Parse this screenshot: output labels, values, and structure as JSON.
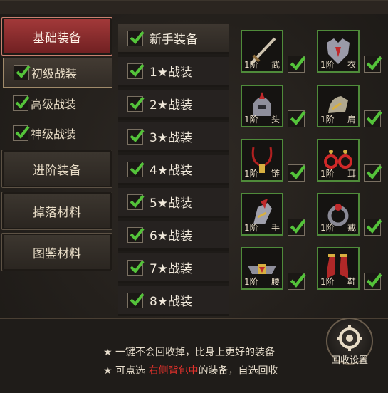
{
  "categories": [
    {
      "label": "基础装备"
    },
    {
      "label": "进阶装备"
    },
    {
      "label": "掉落材料"
    },
    {
      "label": "图鉴材料"
    }
  ],
  "sub_items": [
    {
      "label": "初级战装"
    },
    {
      "label": "高级战装"
    },
    {
      "label": "神级战装"
    }
  ],
  "mid_list": {
    "header": "新手装备",
    "items": [
      "1★战装",
      "2★战装",
      "3★战装",
      "4★战装",
      "5★战装",
      "6★战装",
      "7★战装",
      "8★战装"
    ]
  },
  "slots": [
    {
      "level": "1阶",
      "part": "武",
      "icon": "sword-icon"
    },
    {
      "level": "1阶",
      "part": "衣",
      "icon": "armor-icon"
    },
    {
      "level": "1阶",
      "part": "头",
      "icon": "helmet-icon"
    },
    {
      "level": "1阶",
      "part": "肩",
      "icon": "shoulder-icon"
    },
    {
      "level": "1阶",
      "part": "链",
      "icon": "necklace-icon"
    },
    {
      "level": "1阶",
      "part": "耳",
      "icon": "earring-icon"
    },
    {
      "level": "1阶",
      "part": "手",
      "icon": "glove-icon"
    },
    {
      "level": "1阶",
      "part": "戒",
      "icon": "ring-icon"
    },
    {
      "level": "1阶",
      "part": "腰",
      "icon": "belt-icon"
    },
    {
      "level": "1阶",
      "part": "鞋",
      "icon": "boots-icon"
    }
  ],
  "tips": {
    "line1": "★ 一键不会回收掉，比身上更好的装备",
    "line2_prefix": "★ 可点选 ",
    "line2_highlight": "右侧背包中",
    "line2_suffix": "的装备，自选回收"
  },
  "recycle_button": {
    "label": "回收设置"
  },
  "colors": {
    "accent_red": "#a43a3a",
    "check_green": "#54c33a",
    "slot_border": "#4f8b3a",
    "highlight": "#e0312b"
  }
}
